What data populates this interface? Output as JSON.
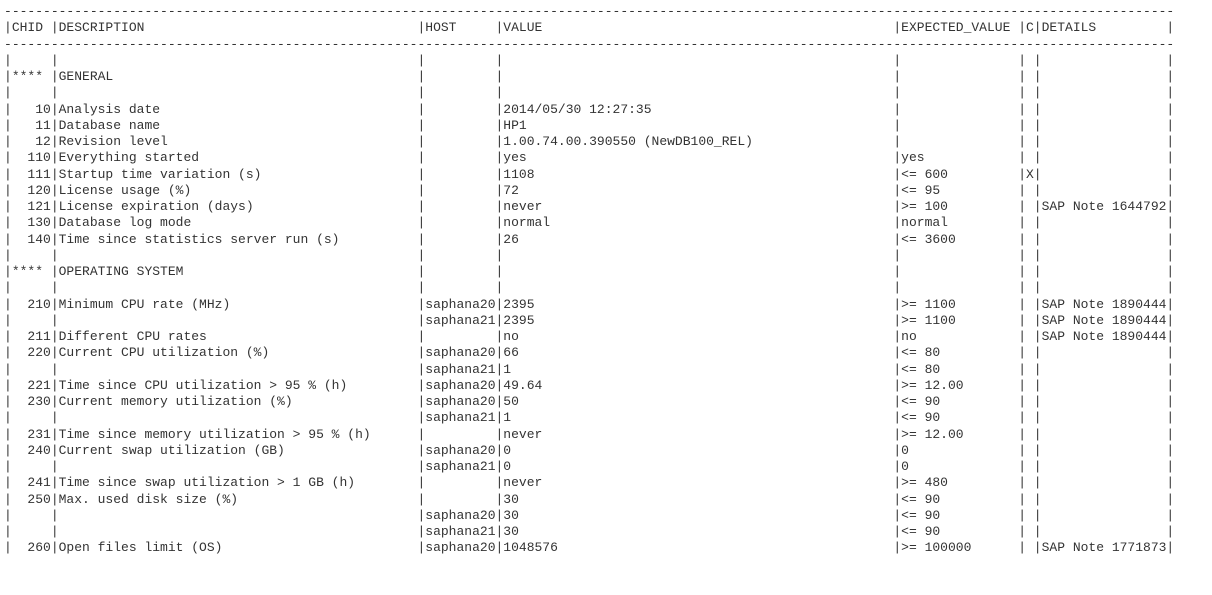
{
  "header": {
    "chid": "CHID",
    "description": "DESCRIPTION",
    "host": "HOST",
    "value": "VALUE",
    "expected_value": "EXPECTED_VALUE",
    "c": "C",
    "details": "DETAILS"
  },
  "dashes": {
    "chid": "-----",
    "description": "----------------------------------------------",
    "host": "---------",
    "value": "--------------------------------------------------",
    "expected_value": "---------------",
    "c": "-",
    "details": "----------------"
  },
  "rows": [
    {
      "chid": "",
      "description": "",
      "host": "",
      "value": "",
      "expected_value": "",
      "c": "",
      "details": ""
    },
    {
      "chid": "****",
      "description": "GENERAL",
      "host": "",
      "value": "",
      "expected_value": "",
      "c": "",
      "details": ""
    },
    {
      "chid": "",
      "description": "",
      "host": "",
      "value": "",
      "expected_value": "",
      "c": "",
      "details": ""
    },
    {
      "chid": "10",
      "description": "Analysis date",
      "host": "",
      "value": "2014/05/30 12:27:35",
      "expected_value": "",
      "c": "",
      "details": ""
    },
    {
      "chid": "11",
      "description": "Database name",
      "host": "",
      "value": "HP1",
      "expected_value": "",
      "c": "",
      "details": ""
    },
    {
      "chid": "12",
      "description": "Revision level",
      "host": "",
      "value": "1.00.74.00.390550 (NewDB100_REL)",
      "expected_value": "",
      "c": "",
      "details": ""
    },
    {
      "chid": "110",
      "description": "Everything started",
      "host": "",
      "value": "yes",
      "expected_value": "yes",
      "c": "",
      "details": ""
    },
    {
      "chid": "111",
      "description": "Startup time variation (s)",
      "host": "",
      "value": "1108",
      "expected_value": "<= 600",
      "c": "X",
      "details": ""
    },
    {
      "chid": "120",
      "description": "License usage (%)",
      "host": "",
      "value": "72",
      "expected_value": "<= 95",
      "c": "",
      "details": ""
    },
    {
      "chid": "121",
      "description": "License expiration (days)",
      "host": "",
      "value": "never",
      "expected_value": ">= 100",
      "c": "",
      "details": "SAP Note 1644792"
    },
    {
      "chid": "130",
      "description": "Database log mode",
      "host": "",
      "value": "normal",
      "expected_value": "normal",
      "c": "",
      "details": ""
    },
    {
      "chid": "140",
      "description": "Time since statistics server run (s)",
      "host": "",
      "value": "26",
      "expected_value": "<= 3600",
      "c": "",
      "details": ""
    },
    {
      "chid": "",
      "description": "",
      "host": "",
      "value": "",
      "expected_value": "",
      "c": "",
      "details": ""
    },
    {
      "chid": "****",
      "description": "OPERATING SYSTEM",
      "host": "",
      "value": "",
      "expected_value": "",
      "c": "",
      "details": ""
    },
    {
      "chid": "",
      "description": "",
      "host": "",
      "value": "",
      "expected_value": "",
      "c": "",
      "details": ""
    },
    {
      "chid": "210",
      "description": "Minimum CPU rate (MHz)",
      "host": "saphana20",
      "value": "2395",
      "expected_value": ">= 1100",
      "c": "",
      "details": "SAP Note 1890444"
    },
    {
      "chid": "",
      "description": "",
      "host": "saphana21",
      "value": "2395",
      "expected_value": ">= 1100",
      "c": "",
      "details": "SAP Note 1890444"
    },
    {
      "chid": "211",
      "description": "Different CPU rates",
      "host": "",
      "value": "no",
      "expected_value": "no",
      "c": "",
      "details": "SAP Note 1890444"
    },
    {
      "chid": "220",
      "description": "Current CPU utilization (%)",
      "host": "saphana20",
      "value": "66",
      "expected_value": "<= 80",
      "c": "",
      "details": ""
    },
    {
      "chid": "",
      "description": "",
      "host": "saphana21",
      "value": "1",
      "expected_value": "<= 80",
      "c": "",
      "details": ""
    },
    {
      "chid": "221",
      "description": "Time since CPU utilization > 95 % (h)",
      "host": "saphana20",
      "value": "49.64",
      "expected_value": ">= 12.00",
      "c": "",
      "details": ""
    },
    {
      "chid": "230",
      "description": "Current memory utilization (%)",
      "host": "saphana20",
      "value": "50",
      "expected_value": "<= 90",
      "c": "",
      "details": ""
    },
    {
      "chid": "",
      "description": "",
      "host": "saphana21",
      "value": "1",
      "expected_value": "<= 90",
      "c": "",
      "details": ""
    },
    {
      "chid": "231",
      "description": "Time since memory utilization > 95 % (h)",
      "host": "",
      "value": "never",
      "expected_value": ">= 12.00",
      "c": "",
      "details": ""
    },
    {
      "chid": "240",
      "description": "Current swap utilization (GB)",
      "host": "saphana20",
      "value": "0",
      "expected_value": "0",
      "c": "",
      "details": ""
    },
    {
      "chid": "",
      "description": "",
      "host": "saphana21",
      "value": "0",
      "expected_value": "0",
      "c": "",
      "details": ""
    },
    {
      "chid": "241",
      "description": "Time since swap utilization > 1 GB (h)",
      "host": "",
      "value": "never",
      "expected_value": ">= 480",
      "c": "",
      "details": ""
    },
    {
      "chid": "250",
      "description": "Max. used disk size (%)",
      "host": "",
      "value": "30",
      "expected_value": "<= 90",
      "c": "",
      "details": ""
    },
    {
      "chid": "",
      "description": "",
      "host": "saphana20",
      "value": "30",
      "expected_value": "<= 90",
      "c": "",
      "details": ""
    },
    {
      "chid": "",
      "description": "",
      "host": "saphana21",
      "value": "30",
      "expected_value": "<= 90",
      "c": "",
      "details": ""
    },
    {
      "chid": "260",
      "description": "Open files limit (OS)",
      "host": "saphana20",
      "value": "1048576",
      "expected_value": ">= 100000",
      "c": "",
      "details": "SAP Note 1771873"
    }
  ]
}
